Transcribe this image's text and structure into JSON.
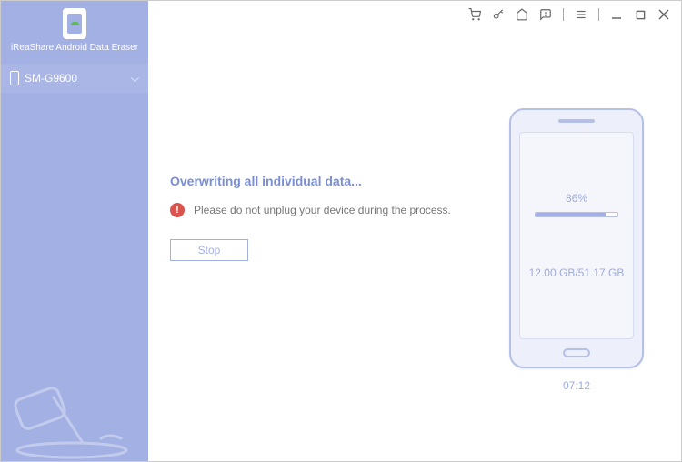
{
  "product_name": "iReaShare Android Data Eraser",
  "sidebar": {
    "device_name": "SM-G9600"
  },
  "status": {
    "title": "Overwriting all individual data...",
    "warning": "Please do not unplug your device during the process.",
    "stop_label": "Stop"
  },
  "progress": {
    "percent_label": "86%",
    "percent_value": 86,
    "storage": "12.00 GB/51.17 GB",
    "elapsed": "07:12"
  }
}
